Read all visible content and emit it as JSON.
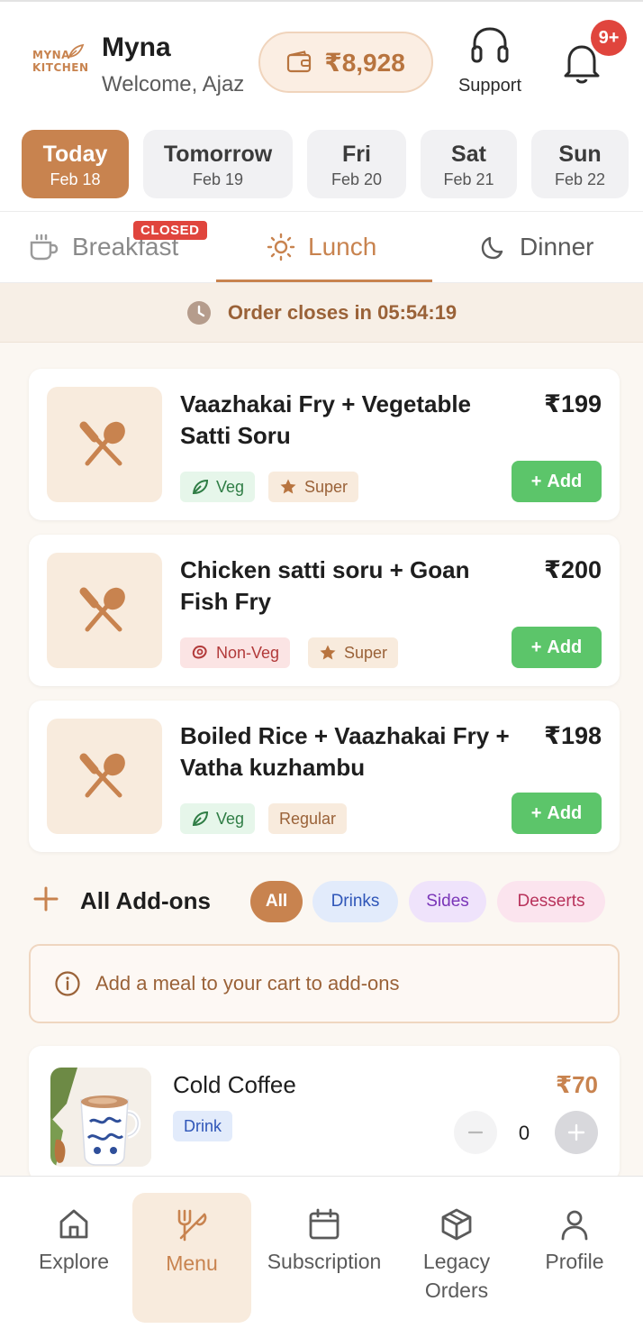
{
  "header": {
    "logo_line1": "MYNA",
    "logo_line2": "KITCHEN",
    "brand": "Myna",
    "welcome": "Welcome, Ajaz",
    "wallet_balance": "₹8,928",
    "support_label": "Support",
    "notification_badge": "9+"
  },
  "dates": [
    {
      "day": "Today",
      "date": "Feb 18",
      "active": true
    },
    {
      "day": "Tomorrow",
      "date": "Feb 19",
      "active": false
    },
    {
      "day": "Fri",
      "date": "Feb 20",
      "active": false
    },
    {
      "day": "Sat",
      "date": "Feb 21",
      "active": false
    },
    {
      "day": "Sun",
      "date": "Feb 22",
      "active": false
    }
  ],
  "meal_tabs": {
    "breakfast": "Breakfast",
    "breakfast_badge": "CLOSED",
    "lunch": "Lunch",
    "dinner": "Dinner",
    "active": "Lunch"
  },
  "countdown": {
    "label": "Order closes in 05:54:19"
  },
  "menu_items": [
    {
      "title": "Vaazhakai Fry + Vegetable Satti Soru",
      "price": "₹199",
      "diet": "Veg",
      "grade": "Super",
      "add_label": "Add"
    },
    {
      "title": "Chicken satti soru + Goan Fish Fry",
      "price": "₹200",
      "diet": "Non-Veg",
      "grade": "Super",
      "add_label": "Add"
    },
    {
      "title": "Boiled Rice + Vaazhakai Fry + Vatha kuzhambu",
      "price": "₹198",
      "diet": "Veg",
      "grade": "Regular",
      "add_label": "Add"
    }
  ],
  "addons": {
    "title": "All Add-ons",
    "filters": [
      "All",
      "Drinks",
      "Sides",
      "Desserts"
    ],
    "active_filter": "All",
    "notice": "Add a meal to your cart to add-ons",
    "items": [
      {
        "name": "Cold Coffee",
        "category": "Drink",
        "price": "₹70",
        "quantity": "0"
      }
    ]
  },
  "bottom_nav": {
    "items": [
      {
        "label": "Explore",
        "icon": "home-icon"
      },
      {
        "label": "Menu",
        "icon": "fork-knife-icon"
      },
      {
        "label": "Subscription",
        "icon": "calendar-icon"
      },
      {
        "label": "Legacy Orders",
        "icon": "box-icon"
      },
      {
        "label": "Profile",
        "icon": "user-icon"
      }
    ],
    "active": "Menu"
  },
  "colors": {
    "accent": "#c8834f",
    "add_green": "#5cc56a",
    "badge_red": "#e0453d"
  }
}
